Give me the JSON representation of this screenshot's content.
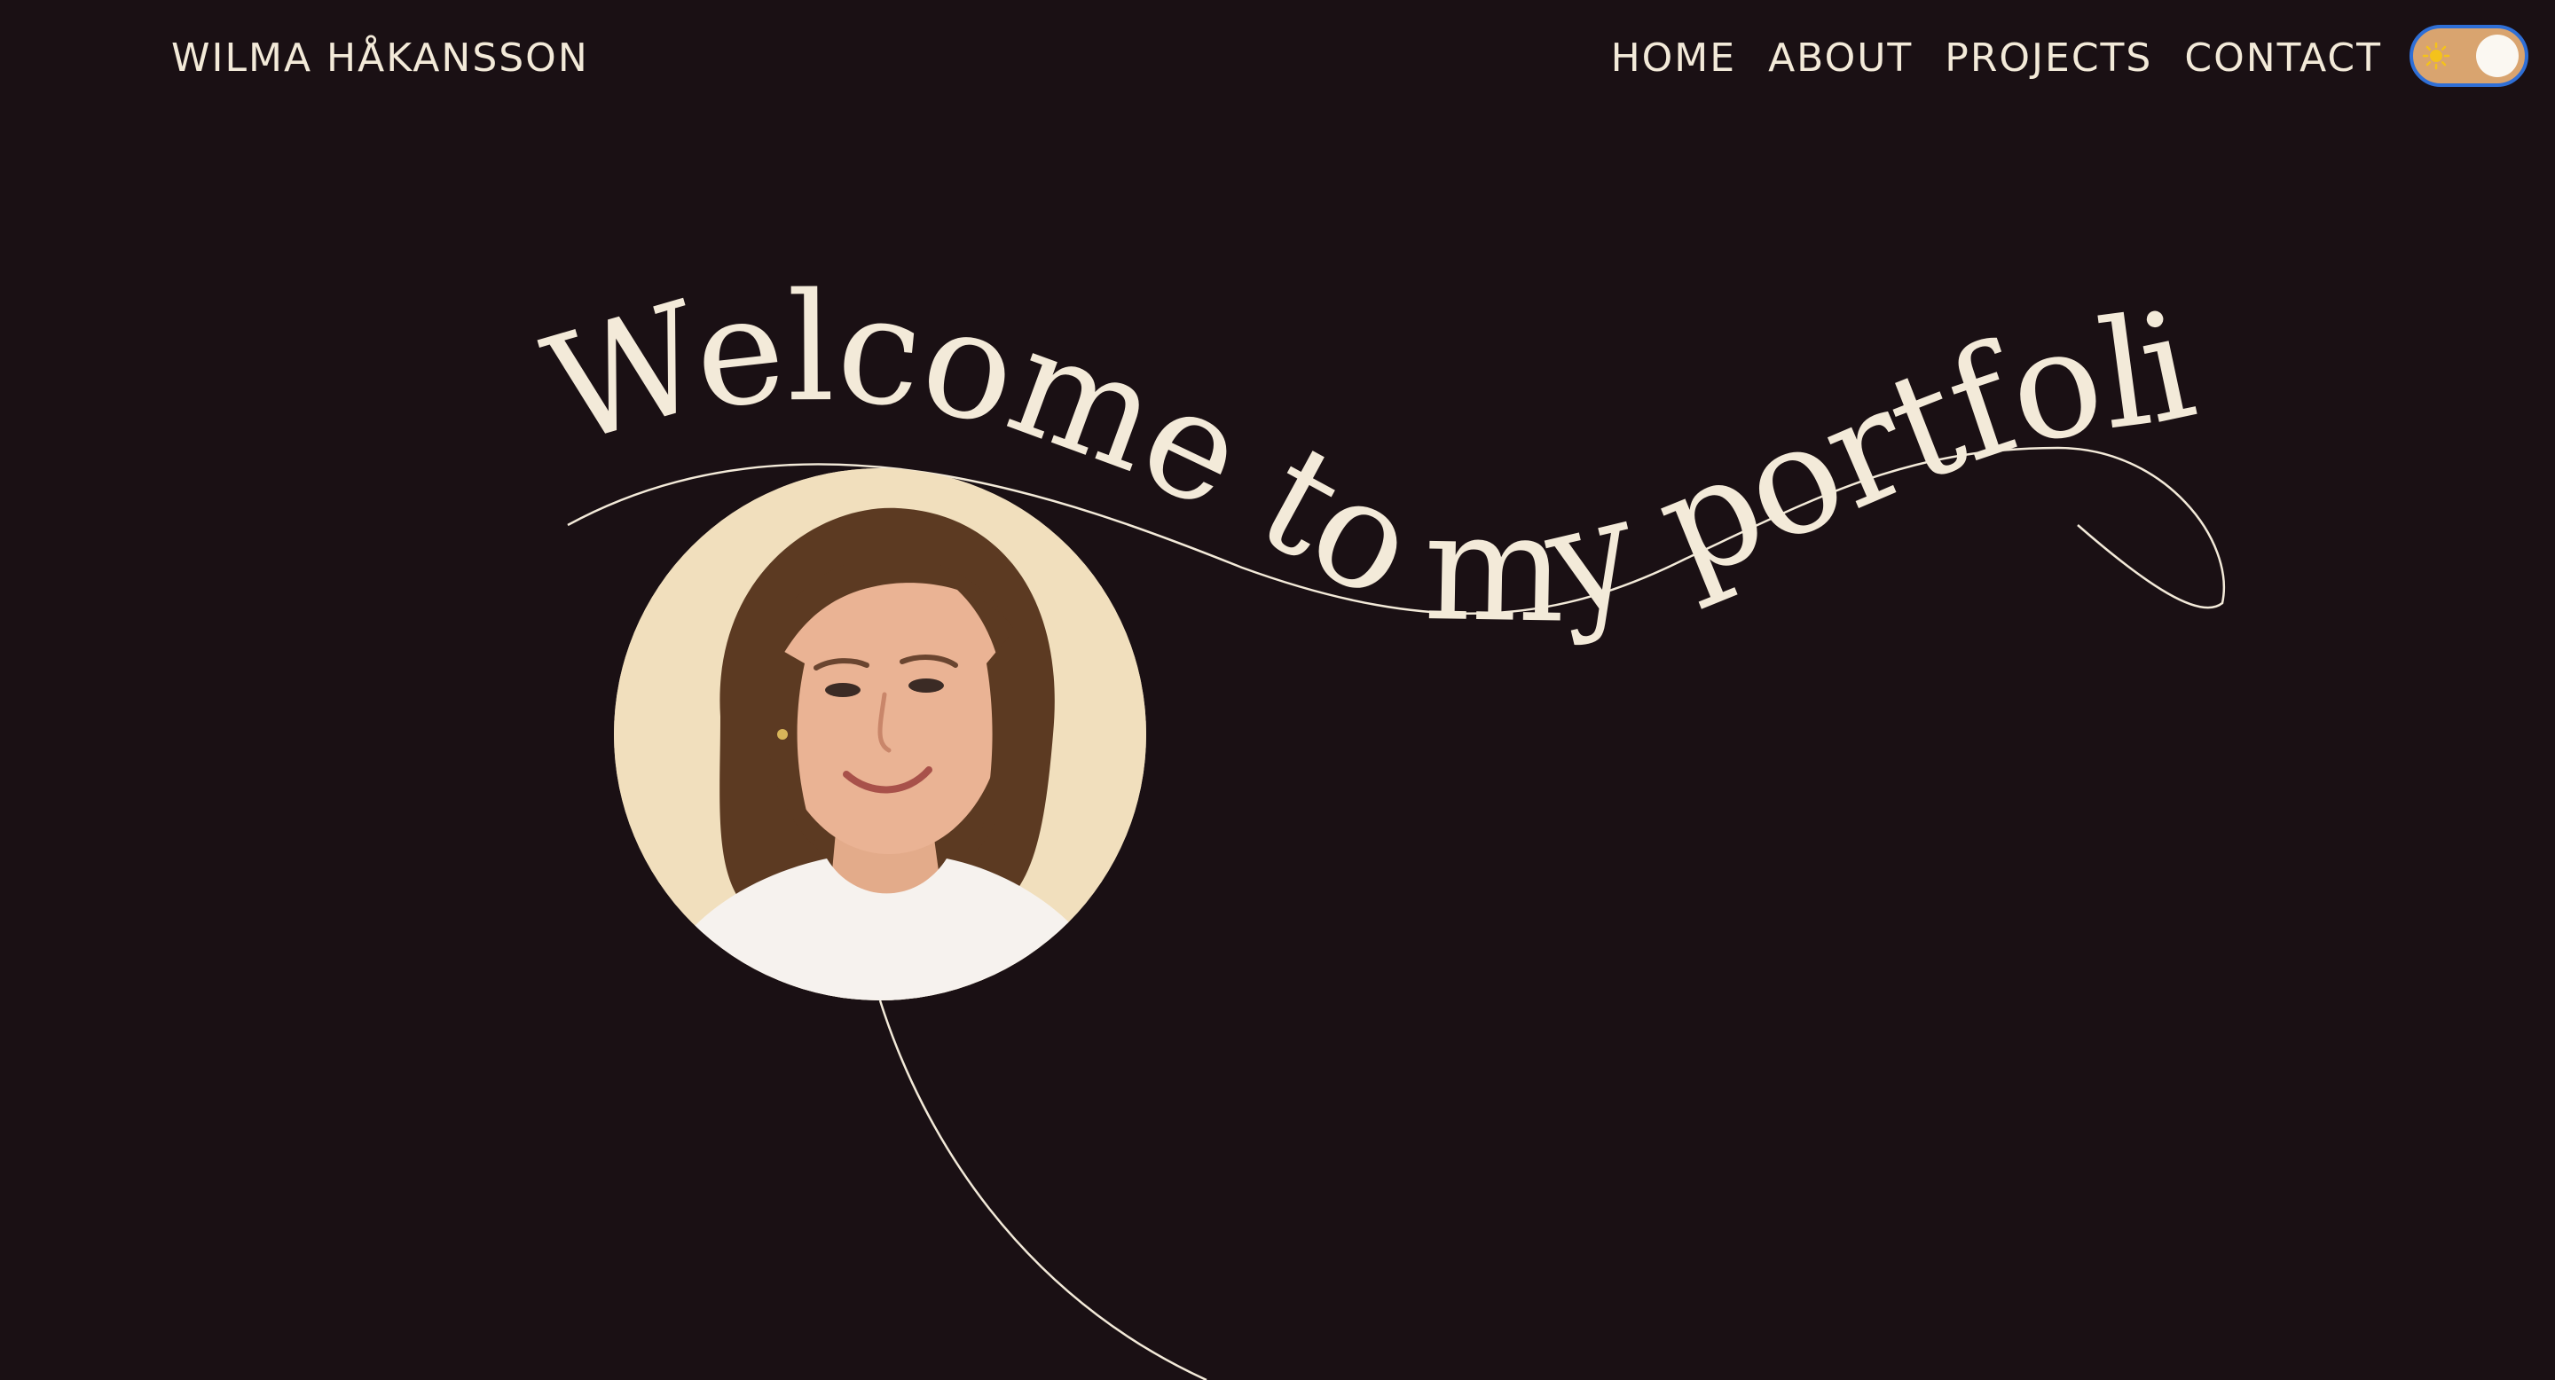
{
  "header": {
    "brand": "WILMA HÅKANSSON",
    "nav": [
      {
        "label": "HOME"
      },
      {
        "label": "ABOUT"
      },
      {
        "label": "PROJECTS"
      },
      {
        "label": "CONTACT"
      }
    ],
    "theme_toggle": {
      "icon": "sun-icon",
      "state": "light-mode-off"
    }
  },
  "hero": {
    "title": "Welcome to my portfolio!"
  },
  "colors": {
    "background": "#1a1014",
    "text": "#f3ead9",
    "toggle_track": "#d9a46f",
    "toggle_border": "#2f6fd6",
    "sun": "#f4c21b"
  }
}
